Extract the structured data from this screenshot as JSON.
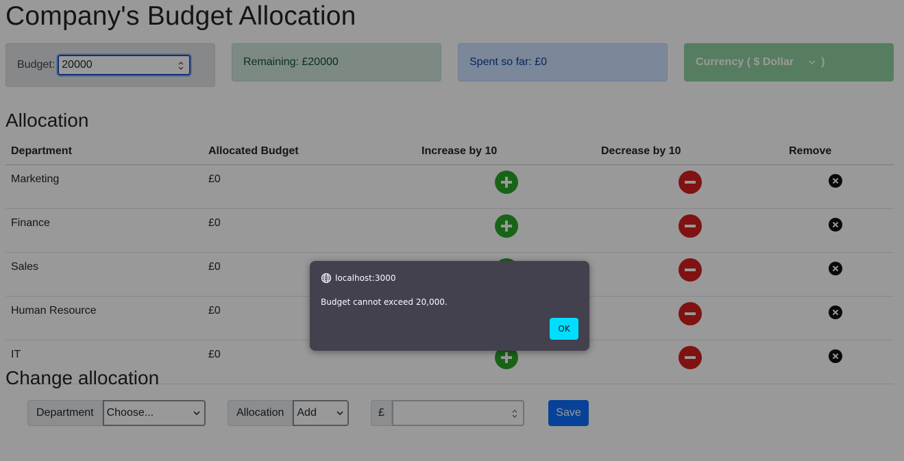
{
  "header": {
    "title": "Company's Budget Allocation"
  },
  "budget": {
    "label": "Budget:",
    "value": "20000"
  },
  "remaining": {
    "text": "Remaining: £20000"
  },
  "spent": {
    "text": "Spent so far: £0"
  },
  "currency": {
    "text_before": "Currency ( $ Dollar",
    "text_after": ")"
  },
  "allocation": {
    "heading": "Allocation",
    "columns": [
      "Department",
      "Allocated Budget",
      "Increase by 10",
      "Decrease by 10",
      "Remove"
    ],
    "rows": [
      {
        "department": "Marketing",
        "budget": "£0"
      },
      {
        "department": "Finance",
        "budget": "£0"
      },
      {
        "department": "Sales",
        "budget": "£0"
      },
      {
        "department": "Human Resource",
        "budget": "£0"
      },
      {
        "department": "IT",
        "budget": "£0"
      }
    ]
  },
  "change": {
    "heading": "Change allocation",
    "department_label": "Department",
    "department_selected": "Choose...",
    "allocation_label": "Allocation",
    "allocation_selected": "Add",
    "currency_symbol": "£",
    "amount_value": "",
    "save_label": "Save"
  },
  "dialog": {
    "origin": "localhost:3000",
    "message": "Budget cannot exceed 20,000.",
    "ok_label": "OK"
  },
  "colors": {
    "increase": "#2aa52a",
    "decrease": "#d51e1e",
    "remove": "#111111",
    "save": "#0d6efd",
    "ok": "#00ddff"
  }
}
